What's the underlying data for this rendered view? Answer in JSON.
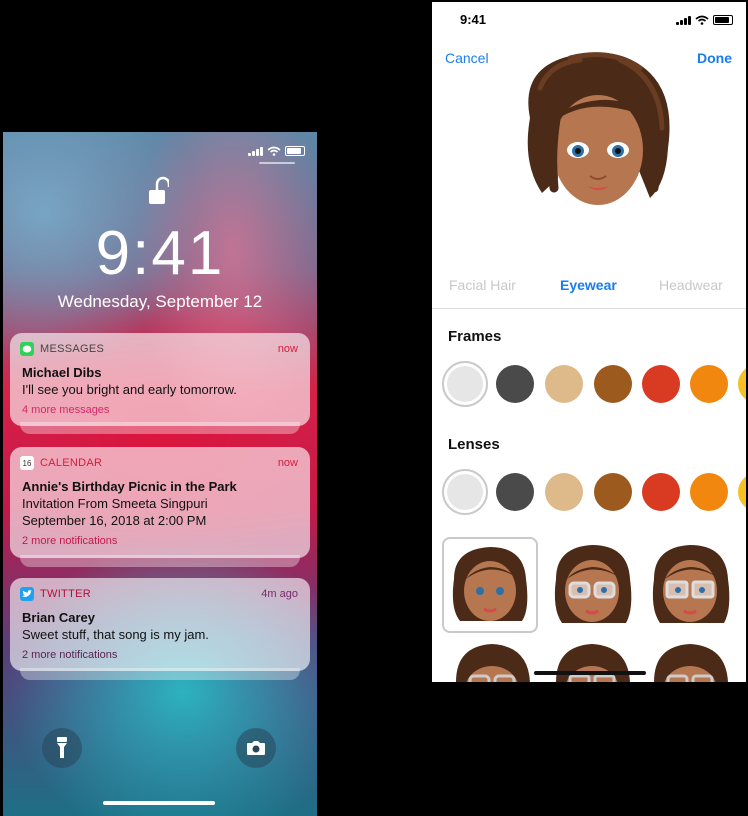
{
  "lock_screen": {
    "time": "9:41",
    "date": "Wednesday, September 12",
    "notifications": [
      {
        "app": "MESSAGES",
        "when": "now",
        "title": "Michael Dibs",
        "body": "I'll see you bright and early tomorrow.",
        "more": "4 more messages",
        "icon": "messages-icon",
        "accent": "#30d158"
      },
      {
        "app": "CALENDAR",
        "when": "now",
        "title": "Annie's Birthday Picnic in the Park",
        "body": "Invitation From Smeeta Singpuri",
        "body2": "September 16, 2018 at 2:00 PM",
        "more": "2 more notifications",
        "icon": "calendar-icon",
        "icon_text": "16",
        "accent": "#e0245e"
      },
      {
        "app": "TWITTER",
        "when": "4m ago",
        "title": "Brian Carey",
        "body": "Sweet stuff, that song is my jam.",
        "more": "2 more notifications",
        "icon": "twitter-icon",
        "accent": "#1da1f2"
      }
    ],
    "buttons": {
      "flashlight": "flashlight-icon",
      "camera": "camera-icon"
    }
  },
  "memoji_editor": {
    "time": "9:41",
    "cancel": "Cancel",
    "done": "Done",
    "tabs": [
      "Facial Hair",
      "Eyewear",
      "Headwear"
    ],
    "active_tab": "Eyewear",
    "sections": {
      "frames": "Frames",
      "lenses": "Lenses"
    },
    "frame_colors": [
      "#e6e6e6",
      "#4a4a4a",
      "#deb98a",
      "#9c5a1e",
      "#d93b22",
      "#f2870f",
      "#f6bf22"
    ],
    "lens_colors": [
      "#e6e6e6",
      "#4a4a4a",
      "#deb98a",
      "#9c5a1e",
      "#d93b22",
      "#f2870f",
      "#f6bf22"
    ],
    "accent": "#1a7cf0"
  }
}
